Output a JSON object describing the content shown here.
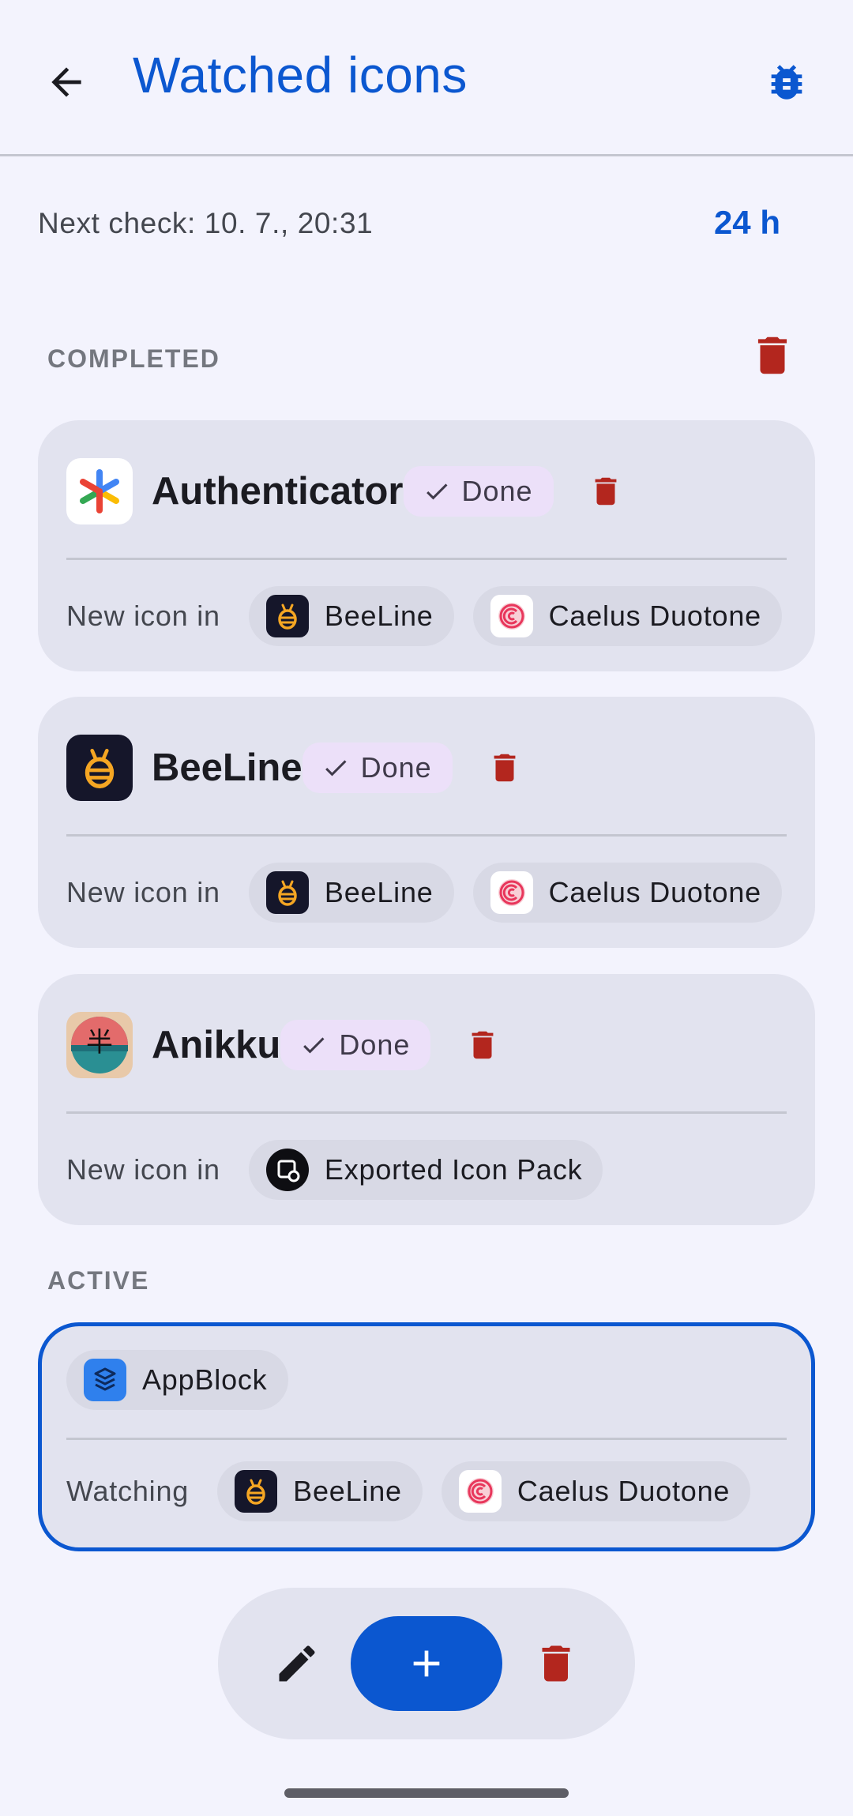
{
  "header": {
    "title": "Watched icons",
    "back_icon": "arrow-back-icon",
    "debug_icon": "bug-icon"
  },
  "status": {
    "next_check": "Next check: 10. 7., 20:31",
    "interval": "24 h"
  },
  "sections": {
    "completed": "COMPLETED",
    "active": "ACTIVE"
  },
  "completed": [
    {
      "name": "Authenticator",
      "icon": "google-authenticator-icon",
      "status": "Done",
      "footer_label": "New icon in",
      "packs": [
        "BeeLine",
        "Caelus Duotone"
      ]
    },
    {
      "name": "BeeLine",
      "icon": "beeline-icon",
      "status": "Done",
      "footer_label": "New icon in",
      "packs": [
        "BeeLine",
        "Caelus Duotone"
      ]
    },
    {
      "name": "Anikku",
      "icon": "anikku-icon",
      "status": "Done",
      "footer_label": "New icon in",
      "packs": [
        "Exported Icon Pack"
      ]
    }
  ],
  "active": [
    {
      "name": "AppBlock",
      "icon": "appblock-icon",
      "footer_label": "Watching",
      "packs": [
        "BeeLine",
        "Caelus Duotone"
      ]
    }
  ],
  "toolbar": {
    "edit_icon": "pencil-icon",
    "add_icon": "plus-icon",
    "delete_icon": "trash-icon"
  },
  "colors": {
    "accent": "#0b57d0",
    "danger": "#b3261e",
    "done_chip": "#ece0f9",
    "card": "#e2e3ef",
    "background": "#f3f3fd"
  }
}
